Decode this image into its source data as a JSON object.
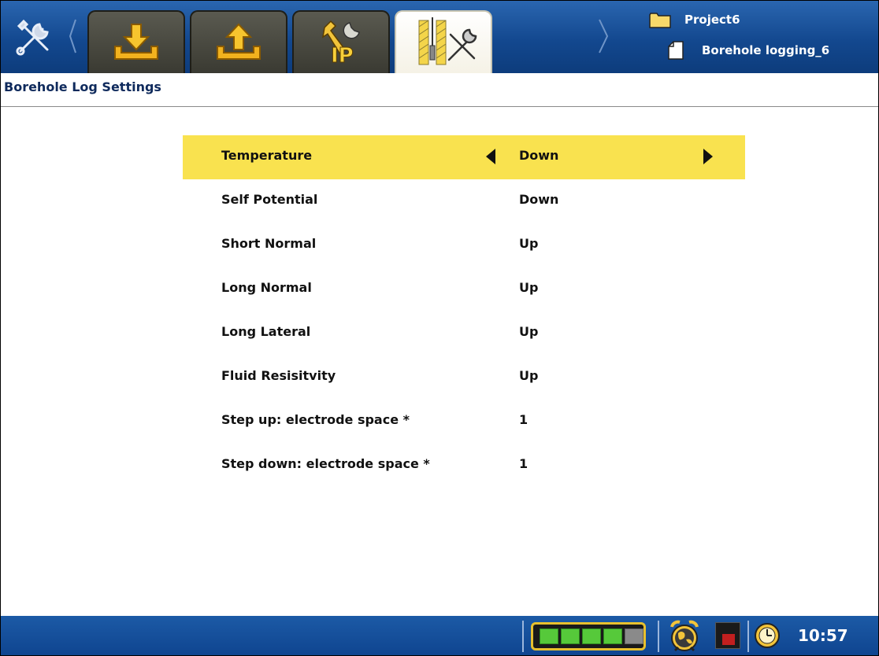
{
  "toolbar": {
    "tabs": [
      {
        "name": "tools",
        "icon": "tools-icon"
      },
      {
        "name": "download",
        "icon": "download-icon"
      },
      {
        "name": "upload",
        "icon": "upload-icon"
      },
      {
        "name": "ip-settings",
        "icon": "ip-settings-icon"
      },
      {
        "name": "borehole-tools",
        "icon": "borehole-tools-icon",
        "active": true
      }
    ]
  },
  "project": {
    "name": "Project6",
    "file": "Borehole logging_6"
  },
  "page": {
    "title": "Borehole Log Settings"
  },
  "settings": [
    {
      "label": "Temperature",
      "value": "Down",
      "selected": true
    },
    {
      "label": "Self Potential",
      "value": "Down"
    },
    {
      "label": "Short Normal",
      "value": "Up"
    },
    {
      "label": "Long Normal",
      "value": "Up"
    },
    {
      "label": "Long Lateral",
      "value": "Up"
    },
    {
      "label": "Fluid Resisitvity",
      "value": "Up"
    },
    {
      "label": "Step up: electrode space *",
      "value": "1"
    },
    {
      "label": "Step down: electrode space *",
      "value": "1"
    }
  ],
  "status": {
    "battery_cells_total": 5,
    "battery_cells_filled": 4,
    "time": "10:57"
  },
  "colors": {
    "accent_selected": "#f9e24f",
    "bar_blue": "#13488f",
    "title_text": "#0f2a5c"
  }
}
